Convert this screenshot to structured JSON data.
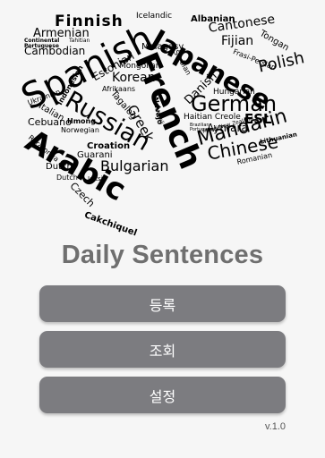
{
  "word_cloud": [
    "Finnish",
    "Icelandic",
    "Albanian",
    "Armenian",
    "Cantonese",
    "Continental Portuguese",
    "Tahitian",
    "Fijian",
    "Tongan",
    "Cambodian",
    "Spanish",
    "Japanese",
    "Malagasy",
    "Serbian",
    "Estonian",
    "Frasi-Persian",
    "Polish",
    "Mongolian",
    "Korean",
    "Indonesian",
    "Afrikaans",
    "Hungarian",
    "French",
    "German",
    "Russian",
    "Italian",
    "Ukrainian",
    "Tagalog",
    "Navajo",
    "Danish",
    "Cebuano",
    "Hmong",
    "Greek",
    "Haitian Creole",
    "ESL",
    "Norwegian",
    "Mandarin",
    "Aymara",
    "Arabic",
    "Croation",
    "Guarani",
    "Chinese",
    "Lithuanian",
    "Roratonga",
    "Maori-New Zealand",
    "Dutch",
    "Bulgarian",
    "Romanian",
    "Czech",
    "Cakchiquel",
    "Nepali",
    "Brazilian Portuguese",
    "Jeltsi",
    "Dutch"
  ],
  "app": {
    "title": "Daily Sentences",
    "version": "v.1.0"
  },
  "menu": {
    "register": "등록",
    "lookup": "조회",
    "settings": "설정"
  }
}
